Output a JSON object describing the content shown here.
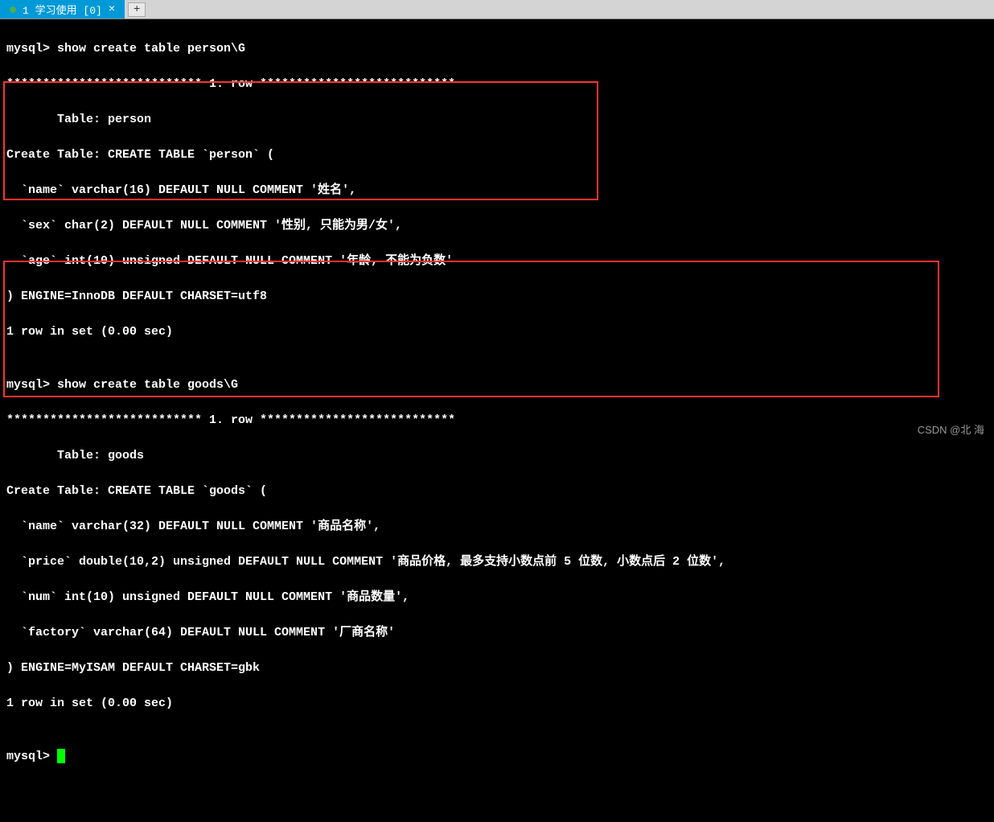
{
  "tab": {
    "label": "1 学习使用 [0]",
    "close": "×",
    "new": "+"
  },
  "terminal": {
    "line1": "mysql> show create table person\\G",
    "line2": "*************************** 1. row ***************************",
    "line3": "       Table: person",
    "line4": "Create Table: CREATE TABLE `person` (",
    "line5": "  `name` varchar(16) DEFAULT NULL COMMENT '姓名',",
    "line6": "  `sex` char(2) DEFAULT NULL COMMENT '性别, 只能为男/女',",
    "line7": "  `age` int(10) unsigned DEFAULT NULL COMMENT '年龄, 不能为负数'",
    "line8": ") ENGINE=InnoDB DEFAULT CHARSET=utf8",
    "line9": "1 row in set (0.00 sec)",
    "line10": "",
    "line11": "mysql> show create table goods\\G",
    "line12": "*************************** 1. row ***************************",
    "line13": "       Table: goods",
    "line14": "Create Table: CREATE TABLE `goods` (",
    "line15": "  `name` varchar(32) DEFAULT NULL COMMENT '商品名称',",
    "line16": "  `price` double(10,2) unsigned DEFAULT NULL COMMENT '商品价格, 最多支持小数点前 5 位数, 小数点后 2 位数',",
    "line17": "  `num` int(10) unsigned DEFAULT NULL COMMENT '商品数量',",
    "line18": "  `factory` varchar(64) DEFAULT NULL COMMENT '厂商名称'",
    "line19": ") ENGINE=MyISAM DEFAULT CHARSET=gbk",
    "line20": "1 row in set (0.00 sec)",
    "line21": "",
    "line22": "mysql> "
  },
  "watermark": "CSDN @北  海"
}
